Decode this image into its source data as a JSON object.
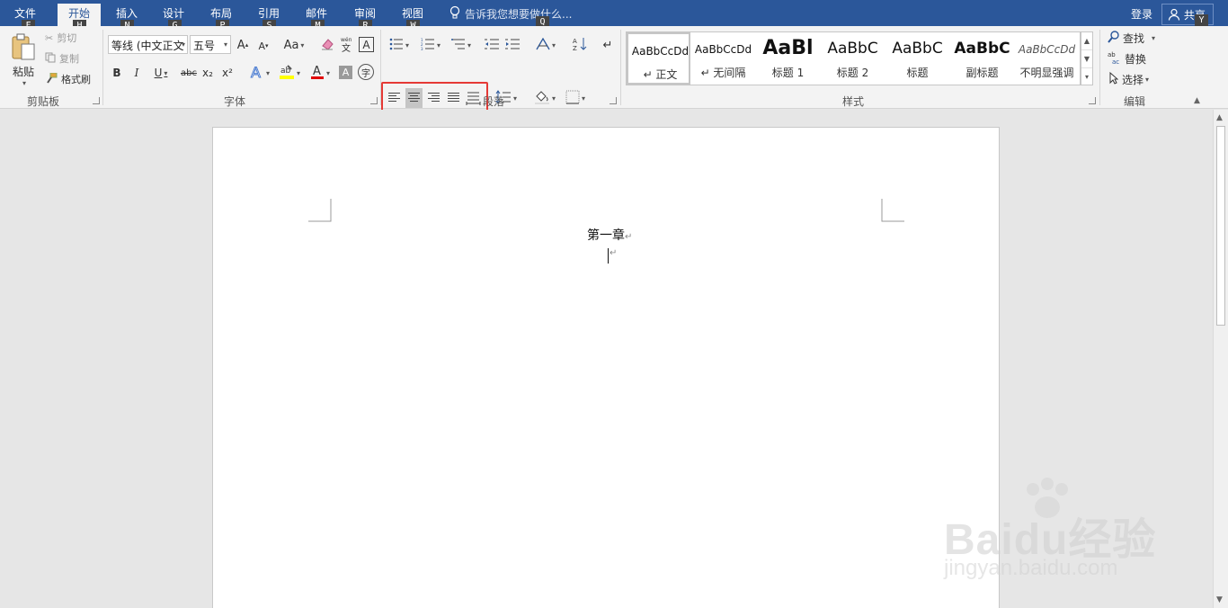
{
  "tabs": {
    "file": "文件",
    "home": "开始",
    "insert": "插入",
    "design": "设计",
    "layout": "布局",
    "references": "引用",
    "mailings": "邮件",
    "review": "审阅",
    "view": "视图"
  },
  "keytips": {
    "file": "F",
    "home": "H",
    "insert": "N",
    "design": "G",
    "layout": "P",
    "references": "S",
    "mailings": "M",
    "review": "R",
    "view": "W",
    "tellme": "Q",
    "share": "Y"
  },
  "tell_me": "告诉我您想要做什么...",
  "account": {
    "login": "登录",
    "share": "共享"
  },
  "clipboard": {
    "paste": "粘贴",
    "cut": "剪切",
    "copy": "复制",
    "format_painter": "格式刷",
    "group_label": "剪贴板"
  },
  "font": {
    "family": "等线 (中文正文",
    "size": "五号",
    "grow": "A",
    "shrink": "A",
    "change_case": "Aa",
    "bold": "B",
    "italic": "I",
    "underline": "U",
    "strikethrough": "abc",
    "subscript": "x₂",
    "superscript": "x²",
    "group_label": "字体"
  },
  "paragraph": {
    "group_label": "段落"
  },
  "styles": {
    "group_label": "样式",
    "items": [
      {
        "sample": "AaBbCcDd",
        "name": "↵ 正文"
      },
      {
        "sample": "AaBbCcDd",
        "name": "↵ 无间隔"
      },
      {
        "sample": "AaBl",
        "name": "标题 1"
      },
      {
        "sample": "AaBbC",
        "name": "标题 2"
      },
      {
        "sample": "AaBbC",
        "name": "标题"
      },
      {
        "sample": "AaBbC",
        "name": "副标题"
      },
      {
        "sample": "AaBbCcDd",
        "name": "不明显强调"
      }
    ]
  },
  "editing": {
    "find": "查找",
    "replace": "替换",
    "select": "选择",
    "group_label": "编辑"
  },
  "document": {
    "heading": "第一章",
    "paragraph_mark": "↵"
  },
  "watermark": {
    "brand": "Baidu经验",
    "url": "jingyan.baidu.com"
  },
  "colors": {
    "ribbon_blue": "#2b579a",
    "highlight_red": "#e53935",
    "font_color_red": "#e00000",
    "highlight_yellow": "#ffff00"
  }
}
